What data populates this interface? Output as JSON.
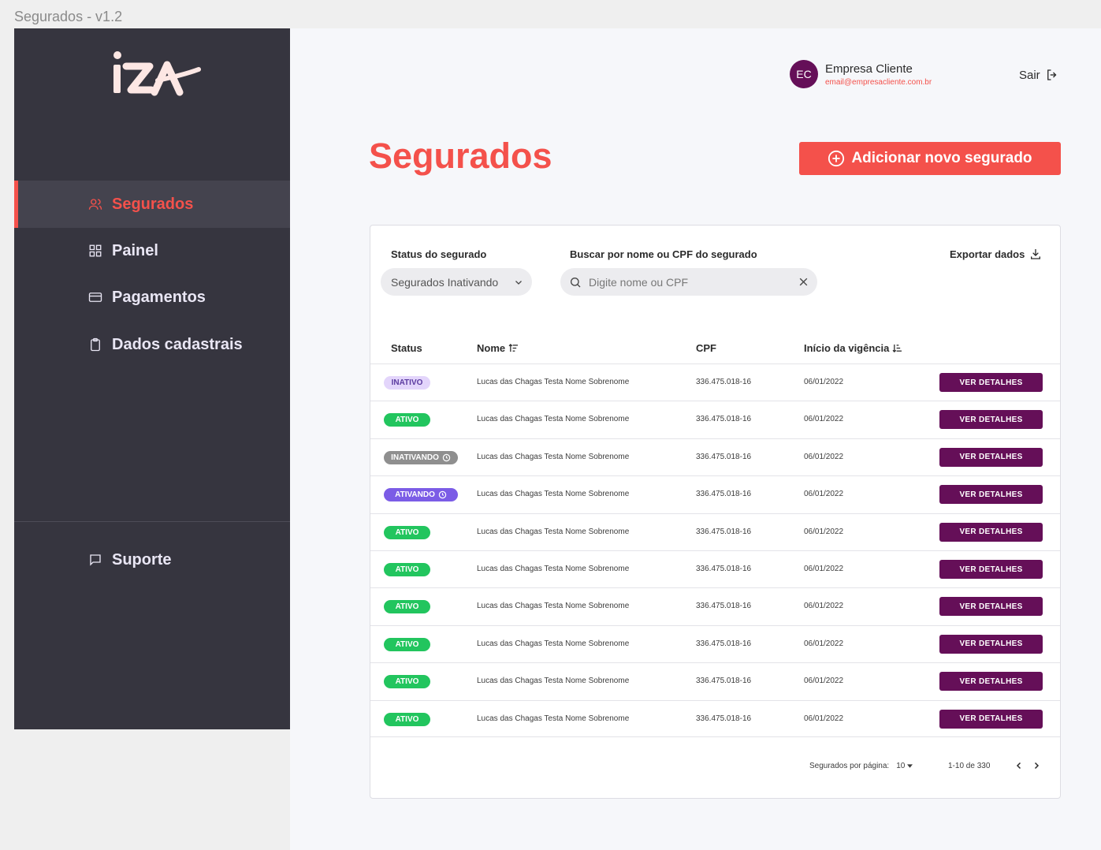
{
  "window": {
    "title": "Segurados - v1.2"
  },
  "brand": {
    "logo_text": "iza",
    "accent_color": "#f4514b",
    "primary_color": "#650f58",
    "sidebar_color": "#36353f"
  },
  "sidebar": {
    "items": [
      {
        "label": "Segurados",
        "icon": "users-icon",
        "active": true
      },
      {
        "label": "Painel",
        "icon": "grid-icon",
        "active": false
      },
      {
        "label": "Pagamentos",
        "icon": "credit-card-icon",
        "active": false
      },
      {
        "label": "Dados cadastrais",
        "icon": "clipboard-icon",
        "active": false
      }
    ],
    "support": {
      "label": "Suporte",
      "icon": "message-icon"
    }
  },
  "header": {
    "user": {
      "initials": "EC",
      "name": "Empresa Cliente",
      "email": "email@empresacliente.com.br"
    },
    "logout_label": "Sair"
  },
  "main": {
    "title": "Segurados",
    "add_button_label": "Adicionar novo segurado"
  },
  "filters": {
    "status_label": "Status do segurado",
    "status_value": "Segurados Inativando",
    "search_label": "Buscar por nome ou CPF do segurado",
    "search_placeholder": "Digite nome ou CPF",
    "export_label": "Exportar dados"
  },
  "table": {
    "columns": [
      "Status",
      "Nome",
      "CPF",
      "Início da vigência"
    ],
    "action_label": "VER DETALHES",
    "rows": [
      {
        "status": "INATIVO",
        "name": "Lucas das Chagas Testa Nome Sobrenome",
        "cpf": "336.475.018-16",
        "start": "06/01/2022"
      },
      {
        "status": "ATIVO",
        "name": "Lucas das Chagas Testa Nome Sobrenome",
        "cpf": "336.475.018-16",
        "start": "06/01/2022"
      },
      {
        "status": "INATIVANDO",
        "name": "Lucas das Chagas Testa Nome Sobrenome",
        "cpf": "336.475.018-16",
        "start": "06/01/2022"
      },
      {
        "status": "ATIVANDO",
        "name": "Lucas das Chagas Testa Nome Sobrenome",
        "cpf": "336.475.018-16",
        "start": "06/01/2022"
      },
      {
        "status": "ATIVO",
        "name": "Lucas das Chagas Testa Nome Sobrenome",
        "cpf": "336.475.018-16",
        "start": "06/01/2022"
      },
      {
        "status": "ATIVO",
        "name": "Lucas das Chagas Testa Nome Sobrenome",
        "cpf": "336.475.018-16",
        "start": "06/01/2022"
      },
      {
        "status": "ATIVO",
        "name": "Lucas das Chagas Testa Nome Sobrenome",
        "cpf": "336.475.018-16",
        "start": "06/01/2022"
      },
      {
        "status": "ATIVO",
        "name": "Lucas das Chagas Testa Nome Sobrenome",
        "cpf": "336.475.018-16",
        "start": "06/01/2022"
      },
      {
        "status": "ATIVO",
        "name": "Lucas das Chagas Testa Nome Sobrenome",
        "cpf": "336.475.018-16",
        "start": "06/01/2022"
      },
      {
        "status": "ATIVO",
        "name": "Lucas das Chagas Testa Nome Sobrenome",
        "cpf": "336.475.018-16",
        "start": "06/01/2022"
      }
    ],
    "status_colors": {
      "INATIVO": {
        "bg": "#e3d5fb",
        "fg": "#5b3ba0"
      },
      "ATIVO": {
        "bg": "#22c55e",
        "fg": "#ffffff"
      },
      "INATIVANDO": {
        "bg": "#8f8f8f",
        "fg": "#ffffff"
      },
      "ATIVANDO": {
        "bg": "#7b5ce6",
        "fg": "#ffffff"
      }
    }
  },
  "pagination": {
    "per_page_label": "Segurados por página:",
    "per_page_value": "10",
    "range_label": "1-10 de 330"
  }
}
